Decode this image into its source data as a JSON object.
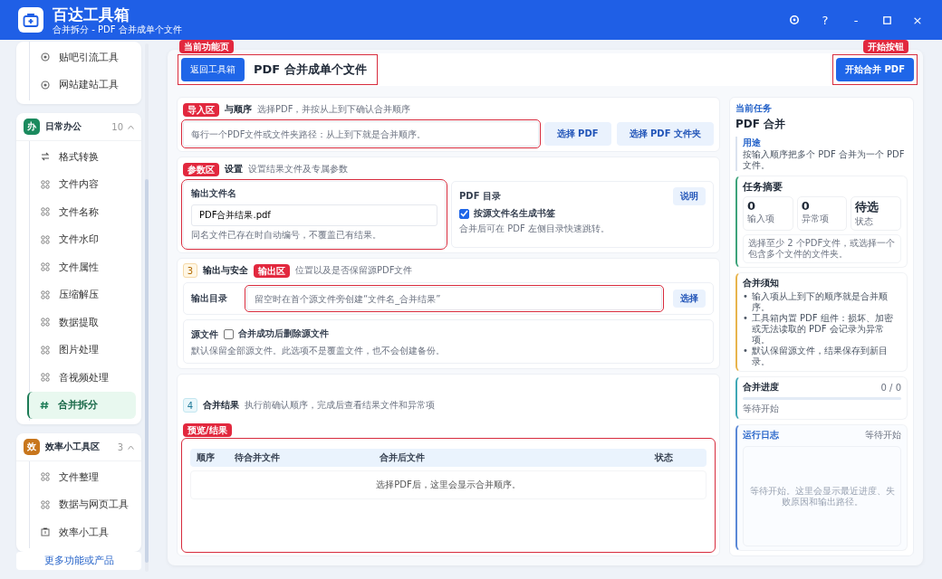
{
  "app": {
    "title": "百达工具箱",
    "subtitle": "合并拆分 - PDF 合并成单个文件"
  },
  "window_controls": [
    {
      "kind": "settings"
    },
    {
      "kind": "help",
      "label": "?"
    },
    {
      "kind": "minimize",
      "label": "-"
    },
    {
      "kind": "maximize"
    },
    {
      "kind": "close",
      "label": "×"
    }
  ],
  "sidebar": {
    "groups": [
      {
        "items": [
          {
            "label": "贴吧引流工具",
            "kind": "target",
            "selected": false
          },
          {
            "label": "网站建站工具",
            "kind": "target",
            "selected": false
          }
        ]
      },
      {
        "badge": "办",
        "color": "#1b8a5e",
        "title": "日常办公",
        "count": "10",
        "expanded": true,
        "items": [
          {
            "label": "格式转换",
            "kind": "swap",
            "selected": false
          },
          {
            "label": "文件内容",
            "kind": "grid",
            "selected": false
          },
          {
            "label": "文件名称",
            "kind": "grid",
            "selected": false
          },
          {
            "label": "文件水印",
            "kind": "grid",
            "selected": false
          },
          {
            "label": "文件属性",
            "kind": "grid",
            "selected": false
          },
          {
            "label": "压缩解压",
            "kind": "grid",
            "selected": false
          },
          {
            "label": "数据提取",
            "kind": "grid",
            "selected": false
          },
          {
            "label": "图片处理",
            "kind": "grid",
            "selected": false
          },
          {
            "label": "音视频处理",
            "kind": "grid",
            "selected": false
          },
          {
            "label": "合并拆分",
            "kind": "hash",
            "selected": true
          }
        ]
      },
      {
        "badge": "效",
        "color": "#c8761c",
        "title": "效率小工具区",
        "count": "3",
        "expanded": true,
        "items": [
          {
            "label": "文件整理",
            "kind": "grid",
            "selected": false
          },
          {
            "label": "数据与网页工具",
            "kind": "grid",
            "selected": false
          },
          {
            "label": "效率小工具",
            "kind": "box",
            "selected": false
          }
        ]
      }
    ],
    "more_button": "更多功能或产品"
  },
  "page_header": {
    "back_button": "返回工具箱",
    "title": "PDF 合并成单个文件",
    "start_button": "开始合并 PDF"
  },
  "annotations": {
    "page": "当前功能页",
    "start": "开始按钮",
    "import": "导入区",
    "params": "参数区",
    "output": "输出区",
    "result": "预览/结果"
  },
  "section_import": {
    "title": "与顺序",
    "hint": "选择PDF，并按从上到下确认合并顺序",
    "placeholder": "每行一个PDF文件或文件夹路径：从上到下就是合并顺序。",
    "buttons": [
      "选择 PDF",
      "选择 PDF 文件夹"
    ]
  },
  "section_params": {
    "title": "设置",
    "hint": "设置结果文件及专属参数",
    "filename": {
      "label": "输出文件名",
      "value": "PDF合并结果.pdf",
      "note": "同名文件已存在时自动编号，不覆盖已有结果。"
    },
    "toc": {
      "label": "PDF 目录",
      "help_button": "说明",
      "checkbox": {
        "label": "按源文件名生成书签",
        "checked": true
      },
      "note": "合并后可在 PDF 左侧目录快速跳转。"
    }
  },
  "section_output": {
    "number": "3",
    "title": "输出与安全",
    "hint": "位置以及是否保留源PDF文件",
    "dir": {
      "label": "输出目录",
      "placeholder": "留空时在首个源文件旁创建“文件名_合并结果”",
      "button": "选择"
    },
    "source": {
      "label": "源文件",
      "checkbox": {
        "label": "合并成功后删除源文件",
        "checked": false
      },
      "note": "默认保留全部源文件。此选项不是覆盖文件，也不会创建备份。"
    }
  },
  "section_result": {
    "number": "4",
    "title": "合并结果",
    "hint": "执行前确认顺序，完成后查看结果文件和异常项",
    "table": {
      "columns": [
        "顺序",
        "待合并文件",
        "合并后文件",
        "状态"
      ],
      "empty_text": "选择PDF后，这里会显示合并顺序。"
    }
  },
  "task_panel": {
    "eyebrow": "当前任务",
    "title": "PDF 合并",
    "purpose": {
      "label": "用途",
      "text": "按输入顺序把多个 PDF 合并为一个 PDF 文件。"
    },
    "summary": {
      "title": "任务摘要",
      "stats": [
        {
          "value": "0",
          "label": "输入项"
        },
        {
          "value": "0",
          "label": "异常项"
        },
        {
          "value": "待选",
          "label": "状态"
        }
      ],
      "note": "选择至少 2 个PDF文件，或选择一个包含多个文件的文件夹。"
    },
    "notice": {
      "title": "合并须知",
      "marker": "•",
      "items": [
        "输入项从上到下的顺序就是合并顺序。",
        "工具箱内置 PDF 组件：损坏、加密或无法读取的 PDF 会记录为异常项。",
        "默认保留源文件，结果保存到新目录。"
      ]
    },
    "progress": {
      "title": "合并进度",
      "count": "0 / 0",
      "level": 0,
      "status": "等待开始"
    },
    "log": {
      "title": "运行日志",
      "status": "等待开始",
      "empty_text": "等待开始。这里会显示最近进度、失败原因和输出路径。"
    }
  }
}
